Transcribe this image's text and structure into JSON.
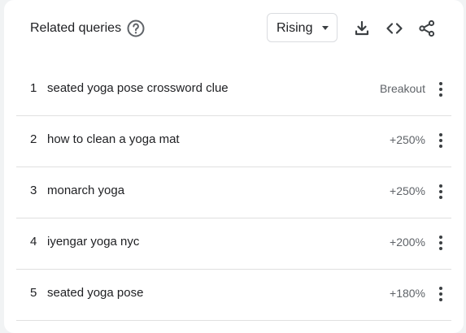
{
  "header": {
    "title": "Related queries",
    "help_icon": "help-circle-icon",
    "dropdown_value": "Rising",
    "tools": [
      "download-icon",
      "embed-code-icon",
      "share-icon"
    ]
  },
  "rows": [
    {
      "rank": "1",
      "query": "seated yoga pose crossword clue",
      "value": "Breakout"
    },
    {
      "rank": "2",
      "query": "how to clean a yoga mat",
      "value": "+250%"
    },
    {
      "rank": "3",
      "query": "monarch yoga",
      "value": "+250%"
    },
    {
      "rank": "4",
      "query": "iyengar yoga nyc",
      "value": "+200%"
    },
    {
      "rank": "5",
      "query": "seated yoga pose",
      "value": "+180%"
    }
  ],
  "colors": {
    "text": "#202124",
    "secondary": "#5f6368",
    "divider": "#e0e0e0",
    "icon": "#3c4043"
  }
}
